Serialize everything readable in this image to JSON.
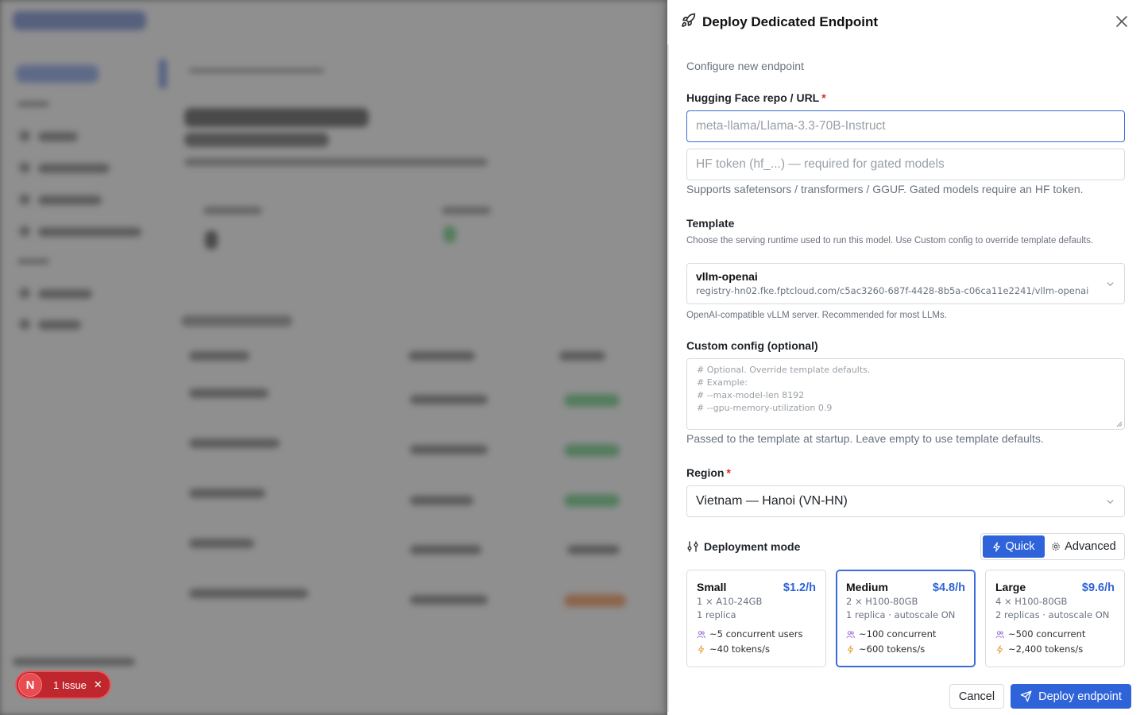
{
  "issue": {
    "avatar_letter": "N",
    "label": "1 Issue"
  },
  "drawer": {
    "title": "Deploy Dedicated Endpoint",
    "subtitle": "Configure new endpoint",
    "hf": {
      "label": "Hugging Face repo / URL",
      "required_mark": "*",
      "repo_placeholder": "meta-llama/Llama-3.3-70B-Instruct",
      "token_placeholder": "HF token (hf_...) — required for gated models",
      "hint": "Supports safetensors / transformers / GGUF. Gated models require an HF token."
    },
    "template": {
      "label": "Template",
      "description": "Choose the serving runtime used to run this model. Use Custom config to override template defaults.",
      "selected_name": "vllm-openai",
      "selected_image": "registry-hn02.fke.fptcloud.com/c5ac3260-687f-4428-8b5a-c06ca11e2241/vllm-openai",
      "hint": "OpenAI-compatible vLLM server. Recommended for most LLMs."
    },
    "custom_config": {
      "label": "Custom config (optional)",
      "placeholder_lines": [
        "# Optional. Override template defaults.",
        "# Example:",
        "# --max-model-len 8192",
        "# --gpu-memory-utilization 0.9"
      ],
      "hint": "Passed to the template at startup. Leave empty to use template defaults."
    },
    "region": {
      "label": "Region",
      "required_mark": "*",
      "value": "Vietnam — Hanoi (VN-HN)"
    },
    "deployment_mode": {
      "label": "Deployment mode",
      "quick_label": "Quick",
      "advanced_label": "Advanced",
      "active": "Quick"
    },
    "tiers": [
      {
        "name": "Small",
        "price": "$1.2/h",
        "gpu": "1 × A10-24GB",
        "replicas": "1 replica",
        "concurrency": "~5 concurrent users",
        "throughput": "~40 tokens/s",
        "selected": false
      },
      {
        "name": "Medium",
        "price": "$4.8/h",
        "gpu": "2 × H100-80GB",
        "replicas": "1 replica · autoscale ON",
        "concurrency": "~100 concurrent",
        "throughput": "~600 tokens/s",
        "selected": true
      },
      {
        "name": "Large",
        "price": "$9.6/h",
        "gpu": "4 × H100-80GB",
        "replicas": "2 replicas · autoscale ON",
        "concurrency": "~500 concurrent",
        "throughput": "~2,400 tokens/s",
        "selected": false
      }
    ],
    "footer": {
      "cancel_label": "Cancel",
      "deploy_label": "Deploy endpoint"
    }
  },
  "colors": {
    "accent": "#2f63d9",
    "required": "#dc2626",
    "issue": "#c0262d",
    "users_icon": "#9b6fd6",
    "bolt_icon": "#e0a030"
  }
}
